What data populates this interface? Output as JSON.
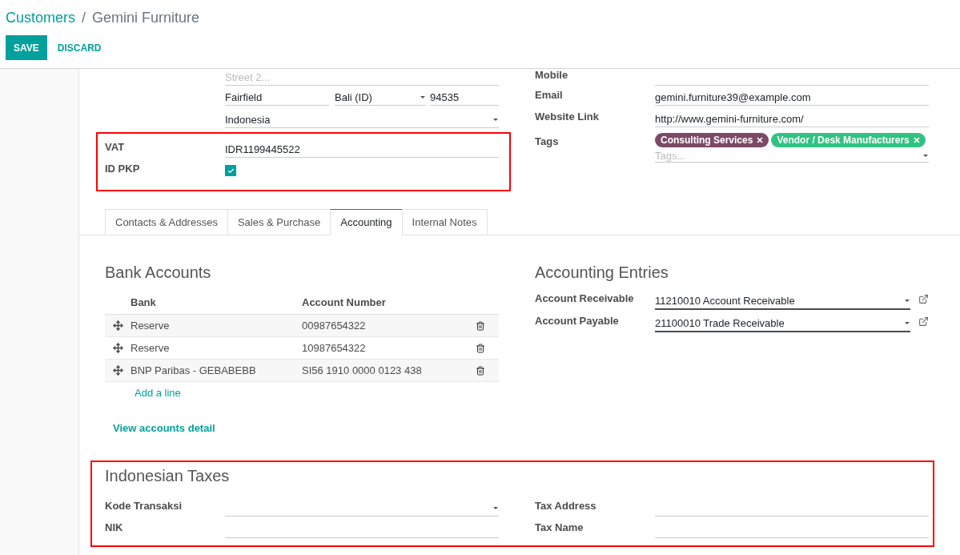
{
  "breadcrumb": {
    "parent": "Customers",
    "separator": "/",
    "current": "Gemini Furniture"
  },
  "buttons": [
    {
      "label": "SAVE",
      "kind": "primary"
    },
    {
      "label": "DISCARD",
      "kind": "link"
    }
  ],
  "address": {
    "street2": {
      "placeholder": "Street 2..."
    },
    "city": {
      "value": "Fairfield"
    },
    "state": {
      "value": "Bali (ID)"
    },
    "zip": {
      "value": "94535"
    },
    "country": {
      "value": "Indonesia"
    }
  },
  "tax_id_group": {
    "highlighted": true,
    "vat": {
      "label": "VAT",
      "value": "IDR1199445522"
    },
    "id_pkp": {
      "label": "ID PKP",
      "checked": true
    }
  },
  "contact_fields": [
    {
      "label": "Mobile"
    },
    {
      "label": "Email",
      "value": "gemini.furniture39@example.com"
    },
    {
      "label": "Website Link",
      "value": "http://www.gemini-furniture.com/"
    }
  ],
  "tags": {
    "label": "Tags",
    "placeholder": "Tags...",
    "items": [
      {
        "label": "Consulting Services",
        "color": "#7c4a67"
      },
      {
        "label": "Vendor / Desk Manufacturers",
        "color": "#30c381"
      }
    ]
  },
  "tabs": [
    {
      "label": "Contacts & Addresses",
      "selected": false
    },
    {
      "label": "Sales & Purchase",
      "selected": false
    },
    {
      "label": "Accounting",
      "selected": true
    },
    {
      "label": "Internal Notes",
      "selected": false
    }
  ],
  "bank_accounts": {
    "title": "Bank Accounts",
    "columns": [
      "Bank",
      "Account Number"
    ],
    "rows": [
      {
        "bank": "Reserve",
        "account_number": "00987654322"
      },
      {
        "bank": "Reserve",
        "account_number": "10987654322"
      },
      {
        "bank": "BNP Paribas - GEBABEBB",
        "account_number": "SI56 1910 0000 0123 438"
      }
    ],
    "add_line": "Add a line",
    "view_detail": "View accounts detail"
  },
  "accounting_entries": {
    "title": "Accounting Entries",
    "fields": [
      {
        "label": "Account Receivable",
        "value": "11210010 Account Receivable"
      },
      {
        "label": "Account Payable",
        "value": "21100010 Trade Receivable"
      }
    ]
  },
  "indonesian_taxes": {
    "highlighted": true,
    "title": "Indonesian Taxes",
    "fields": [
      {
        "label": "Kode Transaksi",
        "kind": "select"
      },
      {
        "label": "Tax Address",
        "kind": "text"
      },
      {
        "label": "NIK",
        "kind": "text"
      },
      {
        "label": "Tax Name",
        "kind": "text"
      }
    ]
  }
}
